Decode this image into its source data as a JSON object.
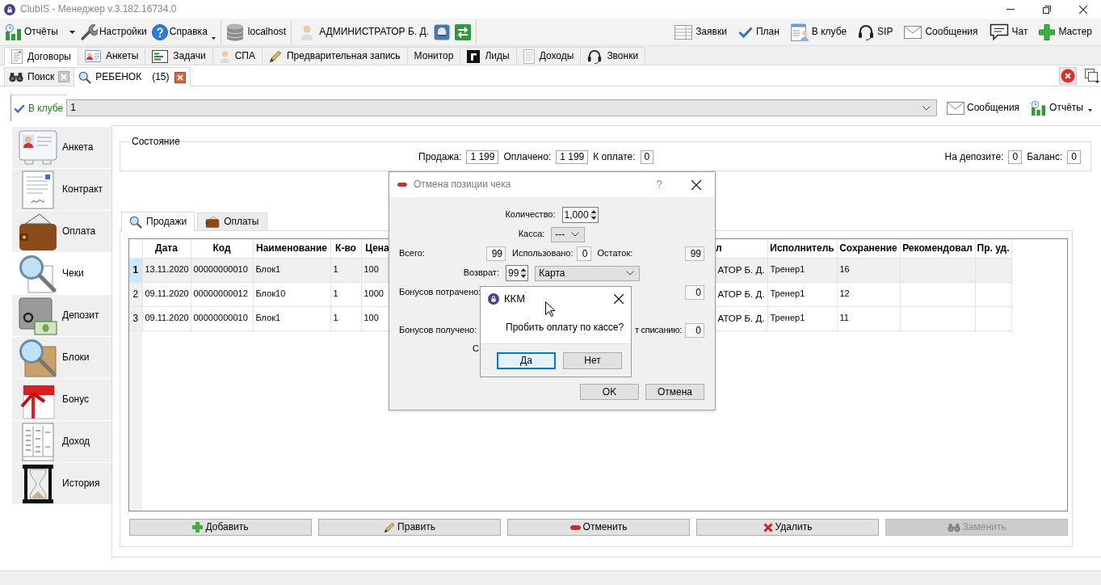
{
  "window": {
    "title": "ClubIS - Менеджер v.3.182.16734.0"
  },
  "toolbar": {
    "groups": [
      [
        {
          "kind": "split",
          "label": "Отчёты"
        },
        {
          "kind": "button",
          "label": "Настройки"
        },
        {
          "kind": "menu",
          "label": "Справка"
        }
      ],
      [
        {
          "kind": "label",
          "label": "localhost"
        }
      ],
      [
        {
          "kind": "label",
          "label": "АДМИНИСТРАТОР Б. Д."
        },
        {
          "kind": "icon_button"
        },
        {
          "kind": "icon_button"
        }
      ]
    ],
    "right": [
      {
        "label": "Заявки"
      },
      {
        "label": "План"
      },
      {
        "label": "В клубе"
      },
      {
        "label": "SIP"
      },
      {
        "label": "Сообщения"
      },
      {
        "label": "Чат"
      },
      {
        "label": "Мастер"
      }
    ]
  },
  "tabs": [
    {
      "label": "Договоры",
      "selected": true
    },
    {
      "label": "Анкеты",
      "selected": false
    },
    {
      "label": "Задачи",
      "selected": false
    },
    {
      "label": "СПА",
      "selected": false
    },
    {
      "label": "Предварительная запись",
      "selected": false
    },
    {
      "label": "Монитор",
      "selected": false
    },
    {
      "label": "Лиды",
      "selected": false
    },
    {
      "label": "Доходы",
      "selected": false
    },
    {
      "label": "Звонки",
      "selected": false
    }
  ],
  "document_tabs": [
    {
      "label": "Поиск",
      "selected": false
    },
    {
      "label": "РЕБЕНОК",
      "count": "(15)",
      "selected": true
    }
  ],
  "filter": {
    "label": "В клубе",
    "value": "1",
    "buttons": [
      {
        "kind": "button",
        "label": "Сообщения"
      },
      {
        "kind": "menu",
        "label": "Отчёты"
      }
    ]
  },
  "sidebar": {
    "items": [
      {
        "label": "Анкета",
        "selected": false
      },
      {
        "label": "Контракт",
        "selected": false
      },
      {
        "label": "Оплата",
        "selected": false
      },
      {
        "label": "Чеки",
        "selected": true
      },
      {
        "label": "Депозит",
        "selected": false
      },
      {
        "label": "Блоки",
        "selected": false
      },
      {
        "label": "Бонус",
        "selected": false
      },
      {
        "label": "Доход",
        "selected": false
      },
      {
        "label": "История",
        "selected": false
      }
    ]
  },
  "state": {
    "title": "Состояние",
    "sales": [
      {
        "label": "Продажа:",
        "value": "1 199"
      },
      {
        "label": "Оплачено:",
        "value": "1 199"
      },
      {
        "label": "К оплате:",
        "value": "0"
      }
    ],
    "balance": [
      {
        "label": "На депозите:",
        "value": "0"
      },
      {
        "label": "Баланс:",
        "value": "0"
      }
    ]
  },
  "inner_tabs": [
    {
      "label": "Продажи",
      "selected": true
    },
    {
      "label": "Оплаты",
      "selected": false
    }
  ],
  "table": {
    "columns": [
      "Дата",
      "Код",
      "Наименование",
      "К-во",
      "Цена",
      "л",
      "Исполнитель",
      "Сохранение",
      "Рекомендовал",
      "Пр. уд."
    ],
    "rows": [
      {
        "number": "1",
        "selected": true,
        "cells": [
          "13.11.2020",
          "00000000010",
          "Блок1",
          "1",
          "100",
          "АТОР Б. Д.",
          "Тренер1",
          "16"
        ]
      },
      {
        "number": "2",
        "selected": false,
        "cells": [
          "09.11.2020",
          "00000000012",
          "Блок10",
          "1",
          "1000",
          "АТОР Б. Д.",
          "Тренер1",
          "12"
        ]
      },
      {
        "number": "3",
        "selected": false,
        "cells": [
          "09.11.2020",
          "00000000010",
          "Блок1",
          "1",
          "100",
          "АТОР Б. Д.",
          "Тренер1",
          "11"
        ]
      }
    ]
  },
  "buttons": [
    {
      "label": "Добавить",
      "disabled": false
    },
    {
      "label": "Править",
      "disabled": false
    },
    {
      "label": "Отменить",
      "disabled": false
    },
    {
      "label": "Удалить",
      "disabled": false
    },
    {
      "label": "Заменить",
      "disabled": true
    }
  ],
  "cancel_dialog": {
    "title": "Отмена позиции чека",
    "help": "?",
    "quantity": {
      "label": "Количество:",
      "value": "1,000"
    },
    "cash_register": {
      "label": "Касса:",
      "value": "---"
    },
    "totals": [
      {
        "label": "Всего:",
        "value": "99"
      },
      {
        "label": "Использовано:",
        "value": "0"
      },
      {
        "label": "Остаток:",
        "value": "99"
      }
    ],
    "refund": {
      "label": "Возврат:",
      "value": "99",
      "method": "Карта"
    },
    "bonuses_spent": {
      "label": "Бонусов потрачено:",
      "value": "0"
    },
    "bonuses_received": {
      "label": "Бонусов получено:"
    },
    "write_off": {
      "label": "т списанию:",
      "value": "0"
    },
    "row_label": "С",
    "buttons": [
      "OK",
      "Отмена"
    ]
  },
  "kkm_dialog": {
    "title": "ККМ",
    "message": "Пробить оплату по кассе?",
    "buttons": [
      {
        "label": "Да",
        "focused": true
      },
      {
        "label": "Нет",
        "focused": false
      }
    ]
  }
}
